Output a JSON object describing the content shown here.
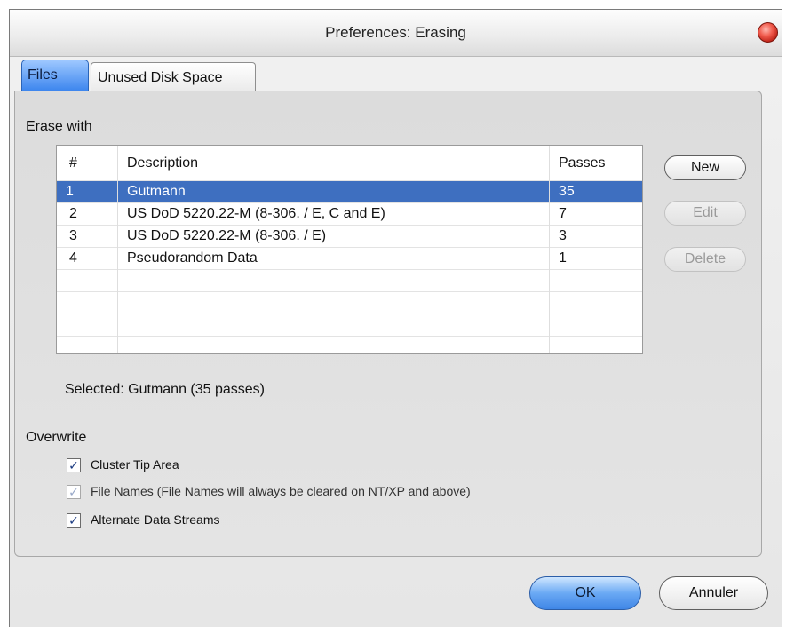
{
  "window": {
    "title": "Preferences: Erasing"
  },
  "tabs": [
    {
      "label": "Files",
      "active": true
    },
    {
      "label": "Unused Disk Space",
      "active": false
    }
  ],
  "erase_with": {
    "heading": "Erase with",
    "columns": [
      "#",
      "Description",
      "Passes"
    ],
    "rows": [
      {
        "num": "1",
        "description": "Gutmann",
        "passes": "35",
        "selected": true
      },
      {
        "num": "2",
        "description": "US DoD 5220.22-M (8-306. / E, C and E)",
        "passes": "7",
        "selected": false
      },
      {
        "num": "3",
        "description": "US DoD 5220.22-M (8-306. / E)",
        "passes": "3",
        "selected": false
      },
      {
        "num": "4",
        "description": "Pseudorandom Data",
        "passes": "1",
        "selected": false
      }
    ],
    "selected_text": "Selected: Gutmann (35 passes)"
  },
  "side_buttons": {
    "new_label": "New",
    "edit_label": "Edit",
    "delete_label": "Delete"
  },
  "overwrite": {
    "heading": "Overwrite",
    "options": [
      {
        "label": "Cluster Tip Area",
        "checked": true,
        "enabled": true
      },
      {
        "label": "File Names (File Names will always be cleared on NT/XP and above)",
        "checked": true,
        "enabled": false
      },
      {
        "label": "Alternate Data Streams",
        "checked": true,
        "enabled": true
      }
    ]
  },
  "footer": {
    "ok_label": "OK",
    "cancel_label": "Annuler"
  },
  "colors": {
    "selection": "#3e6fc0",
    "tab_active": "#3d86ee",
    "close_button": "#d8362a"
  }
}
